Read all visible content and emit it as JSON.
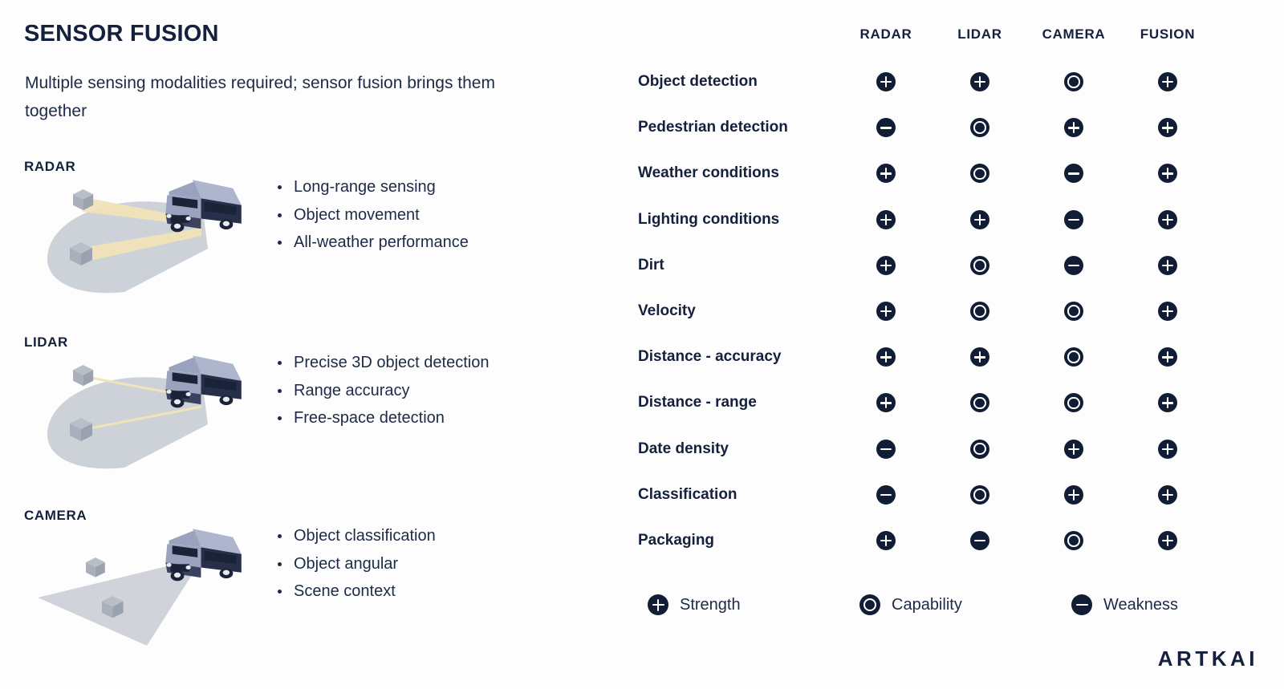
{
  "header": {
    "title": "SENSOR FUSION",
    "subtitle": "Multiple sensing modalities required; sensor fusion brings them together"
  },
  "sensors": [
    {
      "name": "RADAR",
      "illustration": "radar-cone-car-illustration",
      "bullets": [
        "Long-range sensing",
        "Object movement",
        "All-weather performance"
      ]
    },
    {
      "name": "LIDAR",
      "illustration": "lidar-beams-car-illustration",
      "bullets": [
        "Precise 3D object detection",
        "Range accuracy",
        "Free-space detection"
      ]
    },
    {
      "name": "CAMERA",
      "illustration": "camera-fov-car-illustration",
      "bullets": [
        "Object classification",
        "Object angular",
        "Scene context"
      ]
    }
  ],
  "matrix": {
    "columns": [
      "RADAR",
      "LIDAR",
      "CAMERA",
      "FUSION"
    ],
    "rows": [
      {
        "label": "Object detection",
        "values": [
          "strength",
          "strength",
          "capability",
          "strength"
        ]
      },
      {
        "label": "Pedestrian detection",
        "values": [
          "weakness",
          "capability",
          "strength",
          "strength"
        ]
      },
      {
        "label": "Weather conditions",
        "values": [
          "strength",
          "capability",
          "weakness",
          "strength"
        ]
      },
      {
        "label": "Lighting conditions",
        "values": [
          "strength",
          "strength",
          "weakness",
          "strength"
        ]
      },
      {
        "label": "Dirt",
        "values": [
          "strength",
          "capability",
          "weakness",
          "strength"
        ]
      },
      {
        "label": "Velocity",
        "values": [
          "strength",
          "capability",
          "capability",
          "strength"
        ]
      },
      {
        "label": "Distance - accuracy",
        "values": [
          "strength",
          "strength",
          "capability",
          "strength"
        ]
      },
      {
        "label": "Distance - range",
        "values": [
          "strength",
          "capability",
          "capability",
          "strength"
        ]
      },
      {
        "label": "Date density",
        "values": [
          "weakness",
          "capability",
          "strength",
          "strength"
        ]
      },
      {
        "label": "Classification",
        "values": [
          "weakness",
          "capability",
          "strength",
          "strength"
        ]
      },
      {
        "label": "Packaging",
        "values": [
          "strength",
          "weakness",
          "capability",
          "strength"
        ]
      }
    ]
  },
  "legend": [
    {
      "icon": "plus-icon",
      "type": "strength",
      "label": "Strength"
    },
    {
      "icon": "ring-icon",
      "type": "capability",
      "label": "Capability"
    },
    {
      "icon": "minus-icon",
      "type": "weakness",
      "label": "Weakness"
    }
  ],
  "footer": {
    "brand": "ARTKAI"
  },
  "colors": {
    "background": "#fdfdfd",
    "ink": "#14203c",
    "icon": "#111c35",
    "cone": "#c8cdd4",
    "beam": "#f0e3b8",
    "car_body": "#9aa3bd",
    "car_dark": "#272f4a"
  }
}
